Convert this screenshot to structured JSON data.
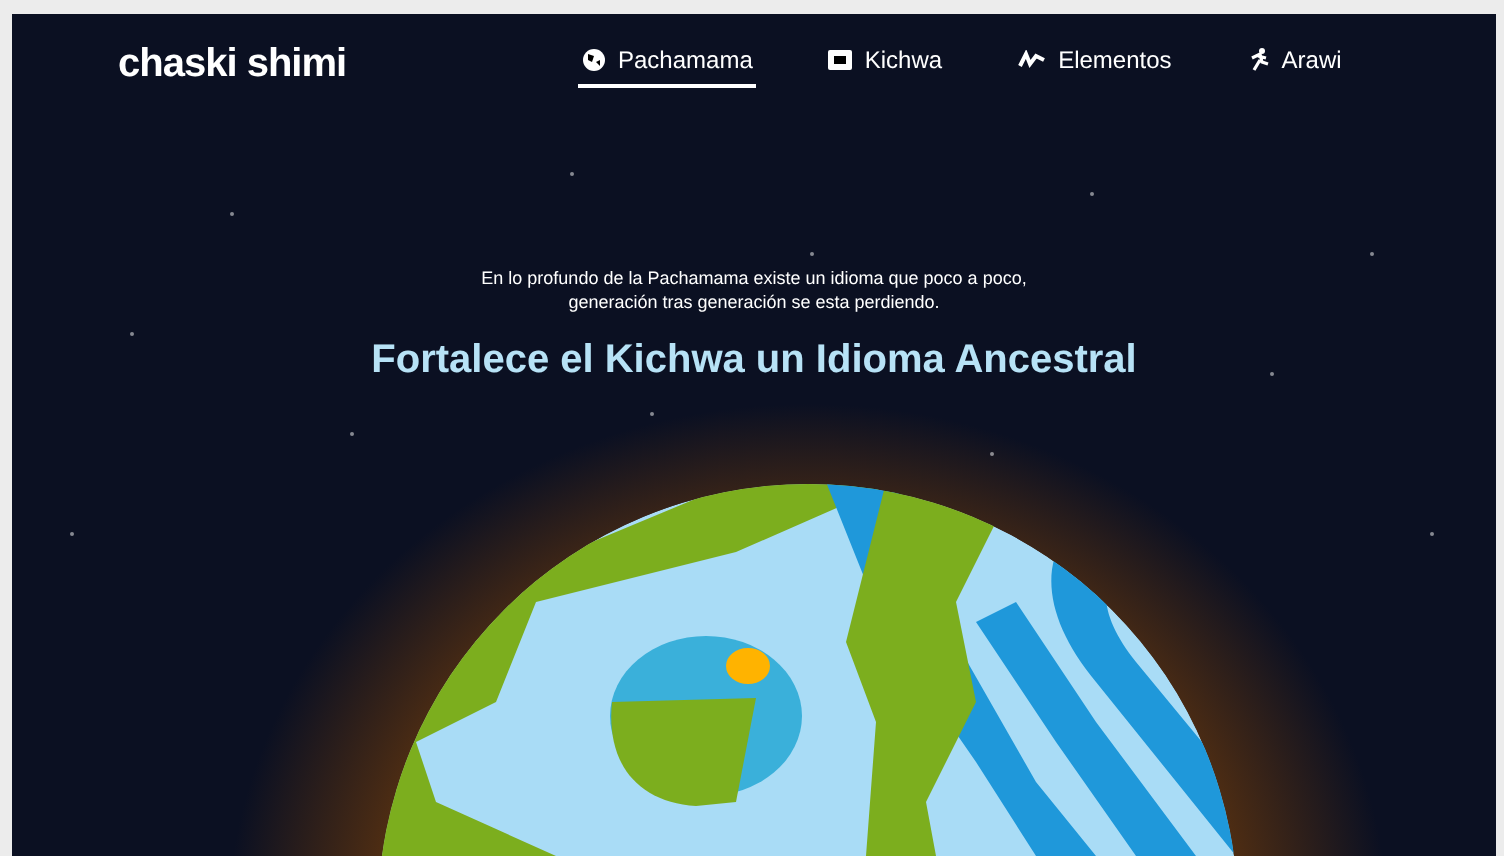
{
  "brand": "chaski shimi",
  "nav": [
    {
      "label": "Pachamama",
      "selected": true
    },
    {
      "label": "Kichwa",
      "selected": false
    },
    {
      "label": "Elementos",
      "selected": false
    },
    {
      "label": "Arawi",
      "selected": false
    }
  ],
  "hero": {
    "intro": "En lo profundo de la Pachamama existe un idioma que poco a poco,\ngeneración tras generación se esta perdiendo.",
    "title": "Fortalece el Kichwa un Idioma Ancestral"
  }
}
